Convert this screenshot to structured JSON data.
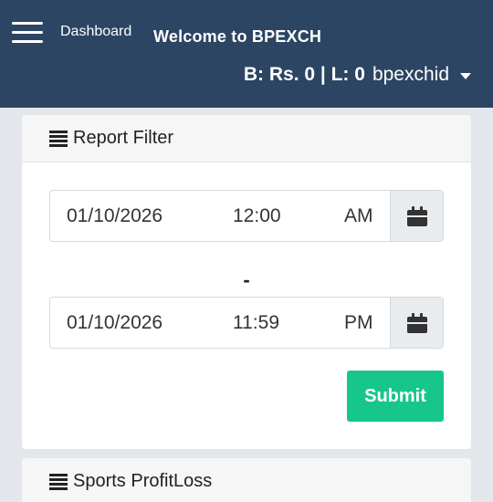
{
  "header": {
    "dashboard_label": "Dashboard",
    "welcome_text": "Welcome to BPEXCH",
    "balance_text": "B: Rs. 0 | L: 0",
    "username": "bpexchid"
  },
  "report_filter": {
    "title": "Report Filter",
    "from": {
      "date": "01/10/2026",
      "time": "12:00",
      "ampm": "AM"
    },
    "separator": "-",
    "to": {
      "date": "01/10/2026",
      "time": "11:59",
      "ampm": "PM"
    },
    "submit_label": "Submit"
  },
  "sports_section": {
    "title": "Sports ProfitLoss"
  },
  "colors": {
    "header_bg": "#2c4563",
    "submit_bg": "#17c68b",
    "page_bg": "#e3e6eb"
  },
  "icons": [
    "menu-icon",
    "list-icon",
    "calendar-icon",
    "caret-down-icon"
  ]
}
